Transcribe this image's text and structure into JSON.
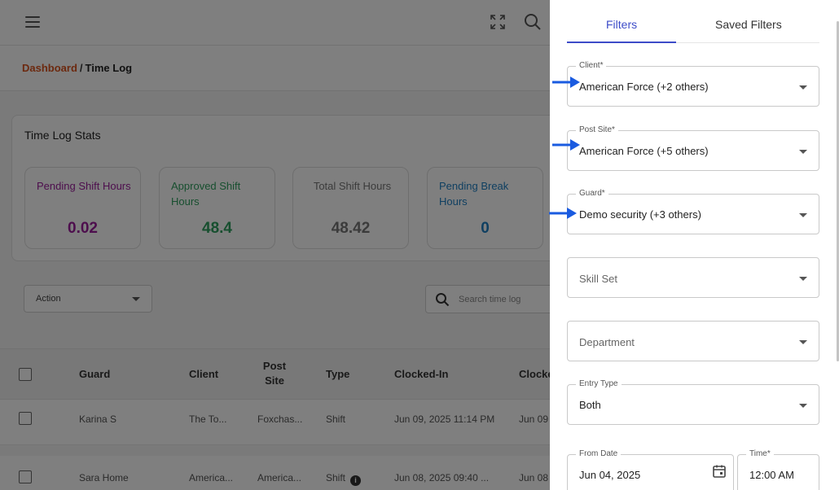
{
  "header": {
    "breadcrumb": {
      "link": "Dashboard",
      "separator": "/",
      "current": "Time Log"
    }
  },
  "stats": {
    "title": "Time Log Stats",
    "items": [
      {
        "label": "Pending Shift Hours",
        "value": "0.02",
        "color": "#9b1d9b"
      },
      {
        "label": "Approved Shift Hours",
        "value": "48.4",
        "color": "#2e9e5e"
      },
      {
        "label": "Total Shift Hours",
        "value": "48.42",
        "color": "#777777"
      },
      {
        "label": "Pending Break Hours",
        "value": "0",
        "color": "#1f7fc2"
      }
    ]
  },
  "toolbar": {
    "action_label": "Action",
    "search_placeholder": "Search time log"
  },
  "table": {
    "columns": {
      "guard": "Guard",
      "client": "Client",
      "post_site": "Post Site",
      "type": "Type",
      "clocked_in": "Clocked-In",
      "clocked_out": "Clocke"
    },
    "rows": [
      {
        "guard": "Karina S",
        "client": "The To...",
        "post_site": "Foxchas...",
        "type": "Shift",
        "clocked_in": "Jun 09, 2025 11:14 PM",
        "clocked_out": "Jun 09"
      },
      {
        "guard": "Sara Home",
        "client": "America...",
        "post_site": "America...",
        "type": "Shift",
        "clocked_in": "Jun 08, 2025 09:40 ...",
        "clocked_out": "Jun 08"
      }
    ]
  },
  "drawer": {
    "tabs": {
      "filters": "Filters",
      "saved": "Saved Filters"
    },
    "client": {
      "label": "Client*",
      "value": "American Force (+2 others)"
    },
    "post_site": {
      "label": "Post Site*",
      "value": "American Force (+5 others)"
    },
    "guard": {
      "label": "Guard*",
      "value": "Demo security (+3 others)"
    },
    "skill_set": {
      "placeholder": "Skill Set"
    },
    "department": {
      "placeholder": "Department"
    },
    "entry_type": {
      "label": "Entry Type",
      "value": "Both"
    },
    "from_date": {
      "label": "From Date",
      "value": "Jun 04, 2025"
    },
    "time": {
      "label": "Time*",
      "value": "12:00 AM"
    }
  },
  "colors": {
    "accent": "#3d4cc8",
    "breadcrumb_link": "#d9531e",
    "arrow": "#1a5be0"
  }
}
